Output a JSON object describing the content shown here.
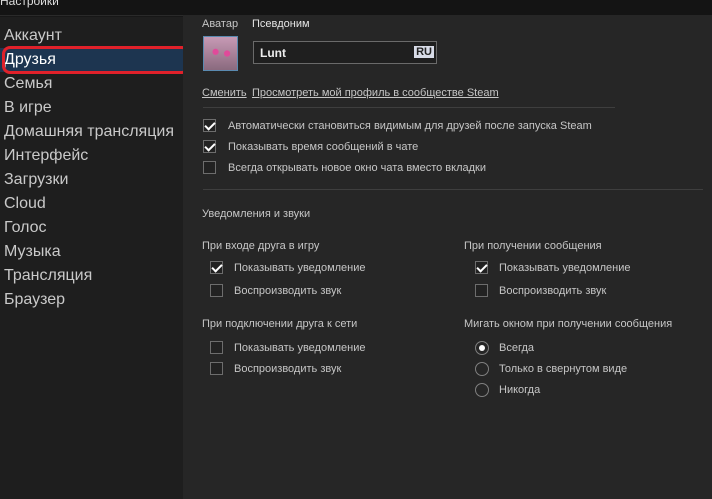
{
  "window": {
    "title": "Настройки"
  },
  "sidebar": {
    "items": [
      {
        "label": "Аккаунт"
      },
      {
        "label": "Друзья"
      },
      {
        "label": "Семья"
      },
      {
        "label": "В игре"
      },
      {
        "label": "Домашняя трансляция"
      },
      {
        "label": "Интерфейс"
      },
      {
        "label": "Загрузки"
      },
      {
        "label": "Cloud"
      },
      {
        "label": "Голос"
      },
      {
        "label": "Музыка"
      },
      {
        "label": "Трансляция"
      },
      {
        "label": "Браузер"
      }
    ],
    "active_index": 1
  },
  "profile": {
    "avatar_label": "Аватар",
    "nickname_label": "Псевдоним",
    "nickname_value": "Lunt",
    "lang_badge": "RU",
    "change_link": "Сменить",
    "view_profile_link": "Просмотреть мой профиль в сообществе Steam"
  },
  "general": [
    {
      "label": "Автоматически становиться видимым для друзей после запуска Steam",
      "checked": true
    },
    {
      "label": "Показывать время сообщений в чате",
      "checked": true
    },
    {
      "label": "Всегда открывать новое окно чата вместо вкладки",
      "checked": false
    }
  ],
  "notifications": {
    "title": "Уведомления и звуки",
    "friend_joins_game": {
      "title": "При входе друга в игру",
      "options": [
        {
          "label": "Показывать уведомление",
          "checked": true
        },
        {
          "label": "Воспроизводить звук",
          "checked": false
        }
      ]
    },
    "friend_online": {
      "title": "При подключении друга к сети",
      "options": [
        {
          "label": "Показывать уведомление",
          "checked": false
        },
        {
          "label": "Воспроизводить звук",
          "checked": false
        }
      ]
    },
    "message_received": {
      "title": "При получении сообщения",
      "options": [
        {
          "label": "Показывать уведомление",
          "checked": true
        },
        {
          "label": "Воспроизводить звук",
          "checked": false
        }
      ]
    },
    "flash_window": {
      "title": "Мигать окном при получении сообщения",
      "options": [
        {
          "label": "Всегда",
          "selected": true
        },
        {
          "label": "Только в свернутом виде",
          "selected": false
        },
        {
          "label": "Никогда",
          "selected": false
        }
      ]
    }
  }
}
